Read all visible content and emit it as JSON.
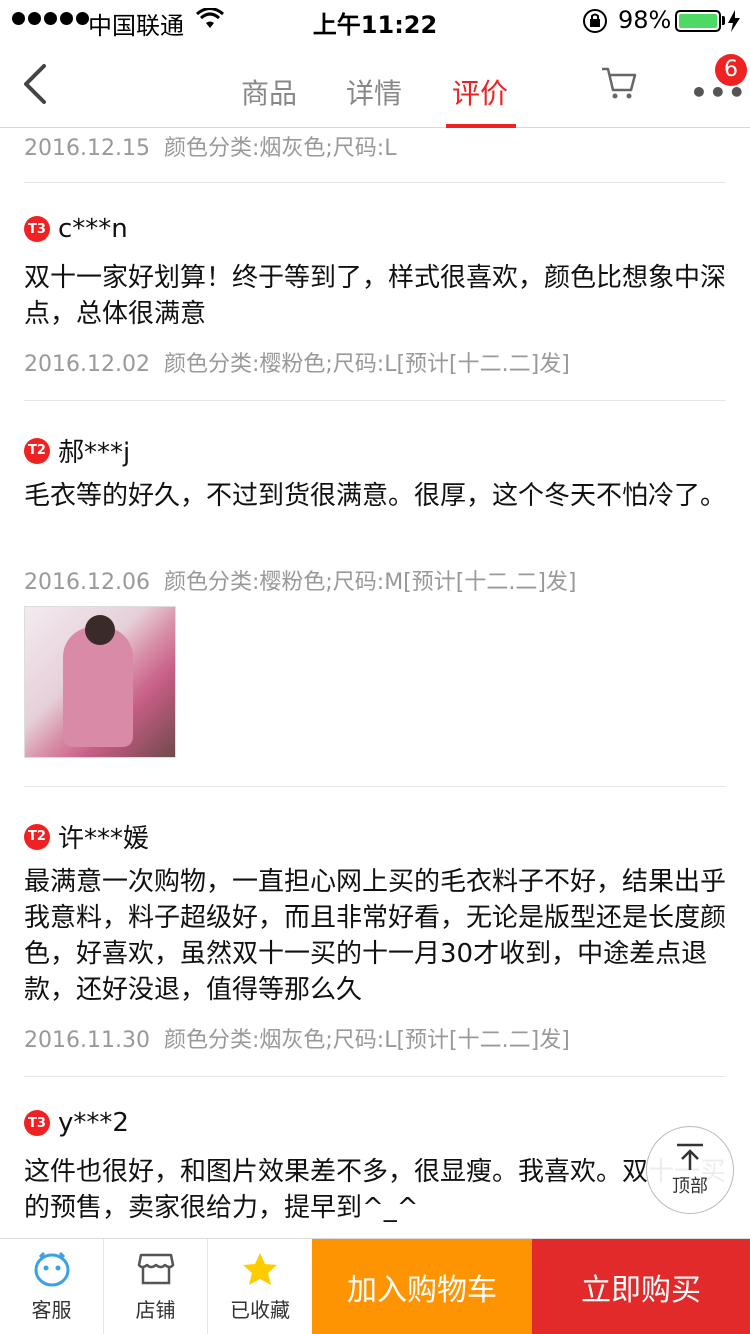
{
  "status_bar": {
    "carrier": "中国联通",
    "time": "上午11:22",
    "battery": "98%"
  },
  "nav": {
    "tabs": [
      {
        "label": "商品"
      },
      {
        "label": "详情"
      },
      {
        "label": "评价",
        "active": true
      }
    ],
    "more_badge": "6"
  },
  "reviews": [
    {
      "partial": true,
      "date": "2016.12.15",
      "spec": "颜色分类:烟灰色;尺码:L"
    },
    {
      "level": "T3",
      "user": "c***n",
      "text": "双十一家好划算！终于等到了，样式很喜欢，颜色比想象中深点，总体很满意",
      "date": "2016.12.02",
      "spec": "颜色分类:樱粉色;尺码:L[预计[十二.二]发]"
    },
    {
      "level": "T2",
      "user": "郝***j",
      "text": "毛衣等的好久，不过到货很满意。很厚，这个冬天不怕冷了。",
      "date": "2016.12.06",
      "spec": "颜色分类:樱粉色;尺码:M[预计[十二.二]发]",
      "has_photo": true
    },
    {
      "level": "T2",
      "user": "许***媛",
      "text": "最满意一次购物，一直担心网上买的毛衣料子不好，结果出乎我意料，料子超级好，而且非常好看，无论是版型还是长度颜色，好喜欢，虽然双十一买的十一月30才收到，中途差点退款，还好没退，值得等那么久",
      "date": "2016.11.30",
      "spec": "颜色分类:烟灰色;尺码:L[预计[十二.二]发]"
    },
    {
      "level": "T3",
      "user": "y***2",
      "text": "这件也很好，和图片效果差不多，很显瘦。我喜欢。双十一买的预售，卖家很给力，提早到^_^"
    }
  ],
  "back_to_top": "顶部",
  "bottom_bar": {
    "service": "客服",
    "store": "店铺",
    "favorited": "已收藏",
    "add_to_cart": "加入购物车",
    "buy_now": "立即购买"
  },
  "colors": {
    "accent_red": "#e22a2a",
    "cart_orange": "#ff9402",
    "meta_gray": "#999999",
    "favorite_star": "#ffcc00",
    "service_blue": "#3ca0e6"
  }
}
